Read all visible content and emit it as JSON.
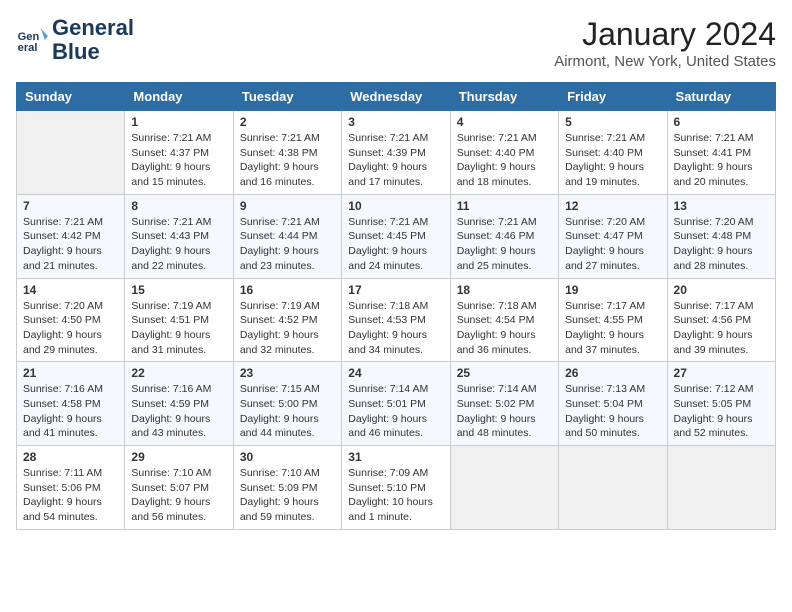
{
  "header": {
    "logo_line1": "General",
    "logo_line2": "Blue",
    "main_title": "January 2024",
    "subtitle": "Airmont, New York, United States"
  },
  "days_of_week": [
    "Sunday",
    "Monday",
    "Tuesday",
    "Wednesday",
    "Thursday",
    "Friday",
    "Saturday"
  ],
  "weeks": [
    [
      {
        "day": "",
        "content": ""
      },
      {
        "day": "1",
        "content": "Sunrise: 7:21 AM\nSunset: 4:37 PM\nDaylight: 9 hours\nand 15 minutes."
      },
      {
        "day": "2",
        "content": "Sunrise: 7:21 AM\nSunset: 4:38 PM\nDaylight: 9 hours\nand 16 minutes."
      },
      {
        "day": "3",
        "content": "Sunrise: 7:21 AM\nSunset: 4:39 PM\nDaylight: 9 hours\nand 17 minutes."
      },
      {
        "day": "4",
        "content": "Sunrise: 7:21 AM\nSunset: 4:40 PM\nDaylight: 9 hours\nand 18 minutes."
      },
      {
        "day": "5",
        "content": "Sunrise: 7:21 AM\nSunset: 4:40 PM\nDaylight: 9 hours\nand 19 minutes."
      },
      {
        "day": "6",
        "content": "Sunrise: 7:21 AM\nSunset: 4:41 PM\nDaylight: 9 hours\nand 20 minutes."
      }
    ],
    [
      {
        "day": "7",
        "content": ""
      },
      {
        "day": "8",
        "content": "Sunrise: 7:21 AM\nSunset: 4:43 PM\nDaylight: 9 hours\nand 22 minutes."
      },
      {
        "day": "9",
        "content": "Sunrise: 7:21 AM\nSunset: 4:44 PM\nDaylight: 9 hours\nand 23 minutes."
      },
      {
        "day": "10",
        "content": "Sunrise: 7:21 AM\nSunset: 4:45 PM\nDaylight: 9 hours\nand 24 minutes."
      },
      {
        "day": "11",
        "content": "Sunrise: 7:21 AM\nSunset: 4:46 PM\nDaylight: 9 hours\nand 25 minutes."
      },
      {
        "day": "12",
        "content": "Sunrise: 7:20 AM\nSunset: 4:47 PM\nDaylight: 9 hours\nand 27 minutes."
      },
      {
        "day": "13",
        "content": "Sunrise: 7:20 AM\nSunset: 4:48 PM\nDaylight: 9 hours\nand 28 minutes."
      }
    ],
    [
      {
        "day": "14",
        "content": "Sunrise: 7:20 AM\nSunset: 4:50 PM\nDaylight: 9 hours\nand 29 minutes."
      },
      {
        "day": "15",
        "content": "Sunrise: 7:19 AM\nSunset: 4:51 PM\nDaylight: 9 hours\nand 31 minutes."
      },
      {
        "day": "16",
        "content": "Sunrise: 7:19 AM\nSunset: 4:52 PM\nDaylight: 9 hours\nand 32 minutes."
      },
      {
        "day": "17",
        "content": "Sunrise: 7:18 AM\nSunset: 4:53 PM\nDaylight: 9 hours\nand 34 minutes."
      },
      {
        "day": "18",
        "content": "Sunrise: 7:18 AM\nSunset: 4:54 PM\nDaylight: 9 hours\nand 36 minutes."
      },
      {
        "day": "19",
        "content": "Sunrise: 7:17 AM\nSunset: 4:55 PM\nDaylight: 9 hours\nand 37 minutes."
      },
      {
        "day": "20",
        "content": "Sunrise: 7:17 AM\nSunset: 4:56 PM\nDaylight: 9 hours\nand 39 minutes."
      }
    ],
    [
      {
        "day": "21",
        "content": "Sunrise: 7:16 AM\nSunset: 4:58 PM\nDaylight: 9 hours\nand 41 minutes."
      },
      {
        "day": "22",
        "content": "Sunrise: 7:16 AM\nSunset: 4:59 PM\nDaylight: 9 hours\nand 43 minutes."
      },
      {
        "day": "23",
        "content": "Sunrise: 7:15 AM\nSunset: 5:00 PM\nDaylight: 9 hours\nand 44 minutes."
      },
      {
        "day": "24",
        "content": "Sunrise: 7:14 AM\nSunset: 5:01 PM\nDaylight: 9 hours\nand 46 minutes."
      },
      {
        "day": "25",
        "content": "Sunrise: 7:14 AM\nSunset: 5:02 PM\nDaylight: 9 hours\nand 48 minutes."
      },
      {
        "day": "26",
        "content": "Sunrise: 7:13 AM\nSunset: 5:04 PM\nDaylight: 9 hours\nand 50 minutes."
      },
      {
        "day": "27",
        "content": "Sunrise: 7:12 AM\nSunset: 5:05 PM\nDaylight: 9 hours\nand 52 minutes."
      }
    ],
    [
      {
        "day": "28",
        "content": "Sunrise: 7:11 AM\nSunset: 5:06 PM\nDaylight: 9 hours\nand 54 minutes."
      },
      {
        "day": "29",
        "content": "Sunrise: 7:10 AM\nSunset: 5:07 PM\nDaylight: 9 hours\nand 56 minutes."
      },
      {
        "day": "30",
        "content": "Sunrise: 7:10 AM\nSunset: 5:09 PM\nDaylight: 9 hours\nand 59 minutes."
      },
      {
        "day": "31",
        "content": "Sunrise: 7:09 AM\nSunset: 5:10 PM\nDaylight: 10 hours\nand 1 minute."
      },
      {
        "day": "",
        "content": ""
      },
      {
        "day": "",
        "content": ""
      },
      {
        "day": "",
        "content": ""
      }
    ]
  ],
  "week7_sunday": {
    "day": "7",
    "content": "Sunrise: 7:21 AM\nSunset: 4:42 PM\nDaylight: 9 hours\nand 21 minutes."
  }
}
